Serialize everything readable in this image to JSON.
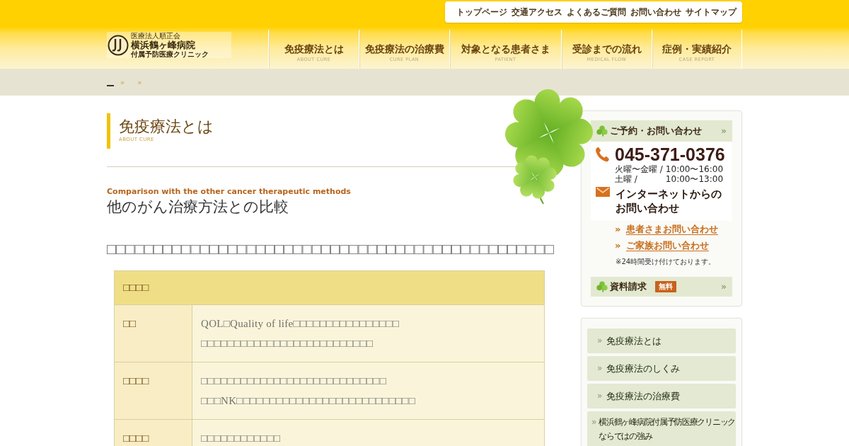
{
  "utility_nav": [
    "トップページ",
    "交通アクセス",
    "よくあるご質問",
    "お問い合わせ",
    "サイトマップ"
  ],
  "logo": {
    "corporation": "医療法人順正会",
    "hospital": "横浜鶴ヶ峰病院",
    "clinic": "付属予防医療クリニック"
  },
  "main_nav": [
    {
      "label": "免疫療法とは",
      "sub": "ABOUT CURE"
    },
    {
      "label": "免疫療法の治療費",
      "sub": "CURE PLAN"
    },
    {
      "label": "対象となる患者さま",
      "sub": "PATIENT"
    },
    {
      "label": "受診までの流れ",
      "sub": "MEDICAL FLOW"
    },
    {
      "label": "症例・実績紹介",
      "sub": "CASE REPORT"
    }
  ],
  "breadcrumb": [
    {
      "kind": "blank_link"
    },
    {
      "kind": "separator",
      "text": "»"
    },
    {
      "kind": "separator",
      "text": "»"
    }
  ],
  "page_heading": {
    "title": "免疫療法とは",
    "sub": "ABOUT CURE"
  },
  "section": {
    "subtitle_en": "Comparison with the other cancer therapeutic methods",
    "title": "他のがん治療方法との比較",
    "paragraph": "□□□□□□□□□□□□□□□□□□□□□□□□□□□□□□□□□□□□□□□□□□□□□□□□"
  },
  "table": {
    "header": "□□□□",
    "rows": [
      {
        "label": "□□",
        "lines": [
          "QOL□Quality of life□□□□□□□□□□□□□□□□",
          "□□□□□□□□□□□□□□□□□□□□□□□□□□"
        ]
      },
      {
        "label": "□□□□",
        "lines": [
          "□□□□□□□□□□□□□□□□□□□□□□□□□□□□",
          "□□□NK□□□□□□□□□□□□□□□□□□□□□□□□□□□"
        ]
      },
      {
        "label": "□□□□",
        "lines": [
          "□□□□□□□□□□□□"
        ]
      }
    ]
  },
  "sidebar": {
    "contact": {
      "title": "ご予約・お問い合わせ",
      "arrow": "»",
      "phone": "045-371-0376",
      "hours": [
        {
          "days": "火曜〜金曜 /",
          "time": "10:00〜16:00"
        },
        {
          "days": "土曜 /",
          "time": "10:00〜13:00"
        }
      ],
      "internet": [
        "インターネットからの",
        "お問い合わせ"
      ],
      "links": [
        {
          "marker": "»",
          "label": "患者さまお問い合わせ"
        },
        {
          "marker": "»",
          "label": "ご家族お問い合わせ"
        }
      ],
      "note": "※24時間受け付けております。"
    },
    "materials": {
      "label": "資料請求",
      "tag": "無料",
      "arrow": "»"
    },
    "menu": [
      {
        "marker": "»",
        "lines": [
          "免疫療法とは"
        ]
      },
      {
        "marker": "»",
        "lines": [
          "免疫療法のしくみ"
        ]
      },
      {
        "marker": "»",
        "lines": [
          "免疫療法の治療費"
        ]
      },
      {
        "marker": "»",
        "lines": [
          "横浜鶴ヶ峰病院付属予防医療クリニック",
          "ならではの強み"
        ]
      }
    ]
  }
}
